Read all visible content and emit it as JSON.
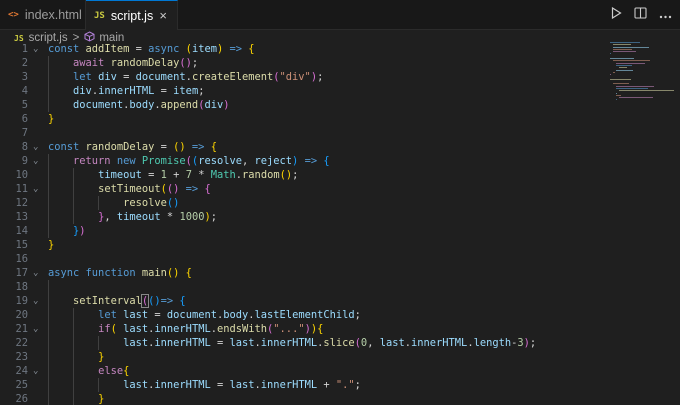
{
  "tabs": [
    {
      "label": "index.html",
      "icon": "<>",
      "active": false
    },
    {
      "label": "script.js",
      "icon": "JS",
      "active": true
    }
  ],
  "tab_close_icon": "×",
  "breadcrumb": {
    "file_icon": "JS",
    "file": "script.js",
    "separator": ">",
    "symbol": "main"
  },
  "actions": [
    "run-icon",
    "split-editor-icon",
    "more-icon"
  ],
  "colors": {
    "background": "#1f1f1f",
    "tab_bar": "#181818",
    "active_tab_border": "#0078d4",
    "keyword": "#569cd6",
    "control": "#c586c0",
    "variable": "#9cdcfe",
    "function": "#dcdcaa",
    "string": "#ce9178",
    "number": "#b5cea8",
    "class": "#4ec9b0"
  },
  "lines": [
    {
      "n": 1,
      "indent": 0,
      "fold": true,
      "code": [
        [
          "kw",
          "const "
        ],
        [
          "fn",
          "addItem"
        ],
        [
          "p",
          " = "
        ],
        [
          "kw",
          "async "
        ],
        [
          "br1",
          "("
        ],
        [
          "var",
          "item"
        ],
        [
          "br1",
          ")"
        ],
        [
          "kw",
          " => "
        ],
        [
          "br1",
          "{"
        ]
      ]
    },
    {
      "n": 2,
      "indent": 1,
      "fold": false,
      "code": [
        [
          "ctrl",
          "await "
        ],
        [
          "fn",
          "randomDelay"
        ],
        [
          "br2",
          "()"
        ],
        [
          "p",
          ";"
        ]
      ]
    },
    {
      "n": 3,
      "indent": 1,
      "fold": false,
      "code": [
        [
          "kw",
          "let "
        ],
        [
          "var",
          "div"
        ],
        [
          "p",
          " = "
        ],
        [
          "var",
          "document"
        ],
        [
          "p",
          "."
        ],
        [
          "fn",
          "createElement"
        ],
        [
          "br2",
          "("
        ],
        [
          "str",
          "\"div\""
        ],
        [
          "br2",
          ")"
        ],
        [
          "p",
          ";"
        ]
      ]
    },
    {
      "n": 4,
      "indent": 1,
      "fold": false,
      "code": [
        [
          "var",
          "div"
        ],
        [
          "p",
          "."
        ],
        [
          "var",
          "innerHTML"
        ],
        [
          "p",
          " = "
        ],
        [
          "var",
          "item"
        ],
        [
          "p",
          ";"
        ]
      ]
    },
    {
      "n": 5,
      "indent": 1,
      "fold": false,
      "code": [
        [
          "var",
          "document"
        ],
        [
          "p",
          "."
        ],
        [
          "var",
          "body"
        ],
        [
          "p",
          "."
        ],
        [
          "fn",
          "append"
        ],
        [
          "br2",
          "("
        ],
        [
          "var",
          "div"
        ],
        [
          "br2",
          ")"
        ]
      ]
    },
    {
      "n": 6,
      "indent": 0,
      "fold": false,
      "code": [
        [
          "br1",
          "}"
        ]
      ]
    },
    {
      "n": 7,
      "indent": 0,
      "fold": false,
      "code": []
    },
    {
      "n": 8,
      "indent": 0,
      "fold": true,
      "code": [
        [
          "kw",
          "const "
        ],
        [
          "fn",
          "randomDelay"
        ],
        [
          "p",
          " = "
        ],
        [
          "br1",
          "()"
        ],
        [
          "kw",
          " => "
        ],
        [
          "br1",
          "{"
        ]
      ]
    },
    {
      "n": 9,
      "indent": 1,
      "fold": true,
      "code": [
        [
          "ctrl",
          "return "
        ],
        [
          "kw",
          "new "
        ],
        [
          "cls",
          "Promise"
        ],
        [
          "br2",
          "("
        ],
        [
          "br3",
          "("
        ],
        [
          "var",
          "resolve"
        ],
        [
          "p",
          ", "
        ],
        [
          "var",
          "reject"
        ],
        [
          "br3",
          ")"
        ],
        [
          "kw",
          " => "
        ],
        [
          "br3",
          "{"
        ]
      ]
    },
    {
      "n": 10,
      "indent": 2,
      "fold": false,
      "code": [
        [
          "var",
          "timeout"
        ],
        [
          "p",
          " = "
        ],
        [
          "num",
          "1"
        ],
        [
          "p",
          " + "
        ],
        [
          "num",
          "7"
        ],
        [
          "p",
          " * "
        ],
        [
          "cls",
          "Math"
        ],
        [
          "p",
          "."
        ],
        [
          "fn",
          "random"
        ],
        [
          "br1",
          "()"
        ],
        [
          "p",
          ";"
        ]
      ]
    },
    {
      "n": 11,
      "indent": 2,
      "fold": true,
      "code": [
        [
          "fn",
          "setTimeout"
        ],
        [
          "br1",
          "("
        ],
        [
          "br2",
          "()"
        ],
        [
          "kw",
          " => "
        ],
        [
          "br2",
          "{"
        ]
      ]
    },
    {
      "n": 12,
      "indent": 3,
      "fold": false,
      "code": [
        [
          "fn",
          "resolve"
        ],
        [
          "br3",
          "()"
        ]
      ]
    },
    {
      "n": 13,
      "indent": 2,
      "fold": false,
      "code": [
        [
          "br2",
          "}"
        ],
        [
          "p",
          ", "
        ],
        [
          "var",
          "timeout"
        ],
        [
          "p",
          " * "
        ],
        [
          "num",
          "1000"
        ],
        [
          "br1",
          ")"
        ],
        [
          "p",
          ";"
        ]
      ]
    },
    {
      "n": 14,
      "indent": 1,
      "fold": false,
      "code": [
        [
          "br3",
          "}"
        ],
        [
          "br2",
          ")"
        ]
      ]
    },
    {
      "n": 15,
      "indent": 0,
      "fold": false,
      "code": [
        [
          "br1",
          "}"
        ]
      ]
    },
    {
      "n": 16,
      "indent": 0,
      "fold": false,
      "code": []
    },
    {
      "n": 17,
      "indent": 0,
      "fold": true,
      "code": [
        [
          "kw",
          "async "
        ],
        [
          "kw",
          "function "
        ],
        [
          "fn",
          "main"
        ],
        [
          "br1",
          "()"
        ],
        [
          "p",
          " "
        ],
        [
          "br1",
          "{"
        ]
      ]
    },
    {
      "n": 18,
      "indent": 1,
      "fold": false,
      "code": []
    },
    {
      "n": 19,
      "indent": 1,
      "fold": true,
      "code": [
        [
          "fn",
          "setInterval"
        ],
        [
          "br2cur",
          "("
        ],
        [
          "br3",
          "()"
        ],
        [
          "kw",
          "=> "
        ],
        [
          "br3",
          "{"
        ]
      ]
    },
    {
      "n": 20,
      "indent": 2,
      "fold": false,
      "code": [
        [
          "kw",
          "let "
        ],
        [
          "var",
          "last"
        ],
        [
          "p",
          " = "
        ],
        [
          "var",
          "document"
        ],
        [
          "p",
          "."
        ],
        [
          "var",
          "body"
        ],
        [
          "p",
          "."
        ],
        [
          "var",
          "lastElementChild"
        ],
        [
          "p",
          ";"
        ]
      ]
    },
    {
      "n": 21,
      "indent": 2,
      "fold": true,
      "code": [
        [
          "ctrl",
          "if"
        ],
        [
          "br1",
          "( "
        ],
        [
          "var",
          "last"
        ],
        [
          "p",
          "."
        ],
        [
          "var",
          "innerHTML"
        ],
        [
          "p",
          "."
        ],
        [
          "fn",
          "endsWith"
        ],
        [
          "br2",
          "("
        ],
        [
          "str",
          "\"...\""
        ],
        [
          "br2",
          ")"
        ],
        [
          "br1",
          ")"
        ],
        [
          "br1",
          "{"
        ]
      ]
    },
    {
      "n": 22,
      "indent": 3,
      "fold": false,
      "code": [
        [
          "var",
          "last"
        ],
        [
          "p",
          "."
        ],
        [
          "var",
          "innerHTML"
        ],
        [
          "p",
          " = "
        ],
        [
          "var",
          "last"
        ],
        [
          "p",
          "."
        ],
        [
          "var",
          "innerHTML"
        ],
        [
          "p",
          "."
        ],
        [
          "fn",
          "slice"
        ],
        [
          "br2",
          "("
        ],
        [
          "num",
          "0"
        ],
        [
          "p",
          ", "
        ],
        [
          "var",
          "last"
        ],
        [
          "p",
          "."
        ],
        [
          "var",
          "innerHTML"
        ],
        [
          "p",
          "."
        ],
        [
          "var",
          "length"
        ],
        [
          "p",
          "-"
        ],
        [
          "num",
          "3"
        ],
        [
          "br2",
          ")"
        ],
        [
          "p",
          ";"
        ]
      ]
    },
    {
      "n": 23,
      "indent": 2,
      "fold": false,
      "code": [
        [
          "br1",
          "}"
        ]
      ]
    },
    {
      "n": 24,
      "indent": 2,
      "fold": true,
      "code": [
        [
          "ctrl",
          "else"
        ],
        [
          "br1",
          "{"
        ]
      ]
    },
    {
      "n": 25,
      "indent": 3,
      "fold": false,
      "code": [
        [
          "var",
          "last"
        ],
        [
          "p",
          "."
        ],
        [
          "var",
          "innerHTML"
        ],
        [
          "p",
          " = "
        ],
        [
          "var",
          "last"
        ],
        [
          "p",
          "."
        ],
        [
          "var",
          "innerHTML"
        ],
        [
          "p",
          " + "
        ],
        [
          "str",
          "\".\""
        ],
        [
          "p",
          ";"
        ]
      ]
    },
    {
      "n": 26,
      "indent": 2,
      "fold": false,
      "code": [
        [
          "br1",
          "}"
        ]
      ]
    }
  ]
}
